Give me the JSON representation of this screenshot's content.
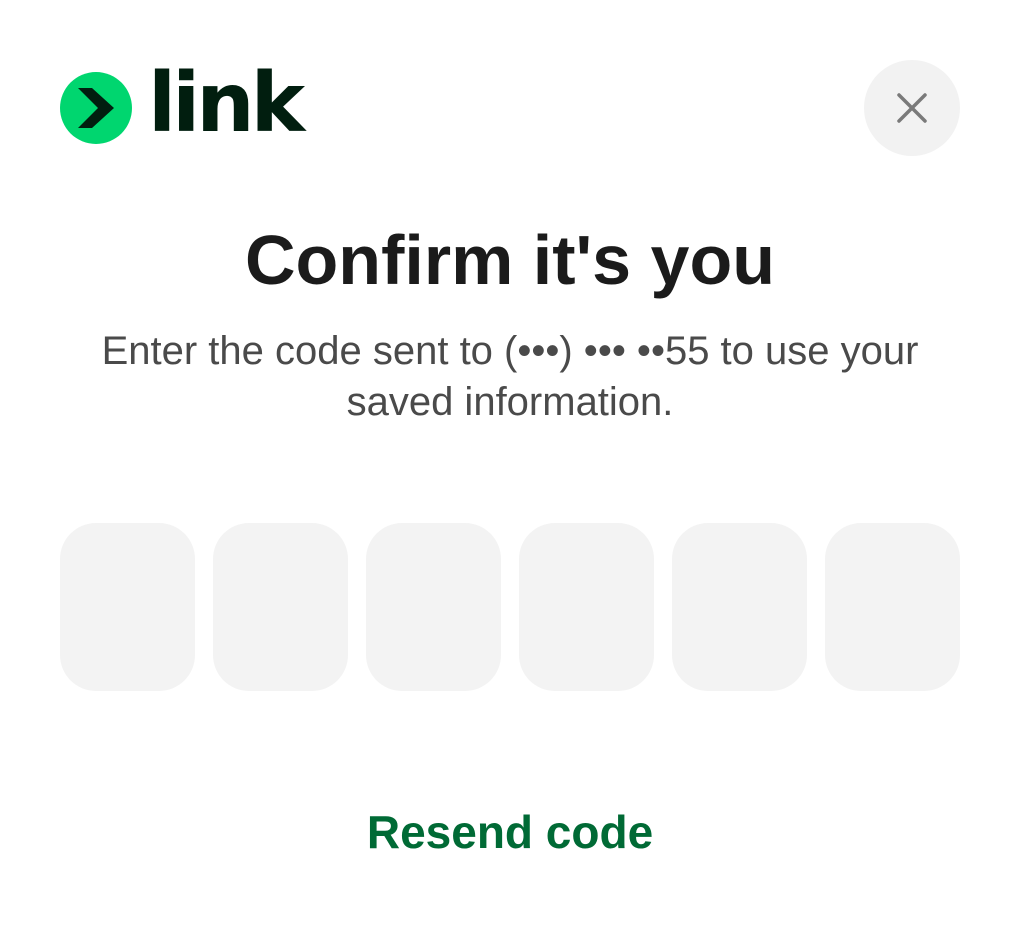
{
  "brand": {
    "wordmark": "link",
    "badge_icon": "chevron-right-icon",
    "badge_color": "#00d66f",
    "chevron_color": "#011e0f",
    "wordmark_color": "#011e0f"
  },
  "close_button": {
    "icon": "close-icon",
    "icon_color": "#7a7a7a"
  },
  "title": "Confirm it's you",
  "subtitle": "Enter the code sent to (•••) ••• ••55 to use your saved information.",
  "code_boxes": [
    {
      "value": ""
    },
    {
      "value": ""
    },
    {
      "value": ""
    },
    {
      "value": ""
    },
    {
      "value": ""
    },
    {
      "value": ""
    }
  ],
  "resend_label": "Resend code",
  "colors": {
    "accent": "#006a35",
    "input_background": "#f3f3f3"
  }
}
